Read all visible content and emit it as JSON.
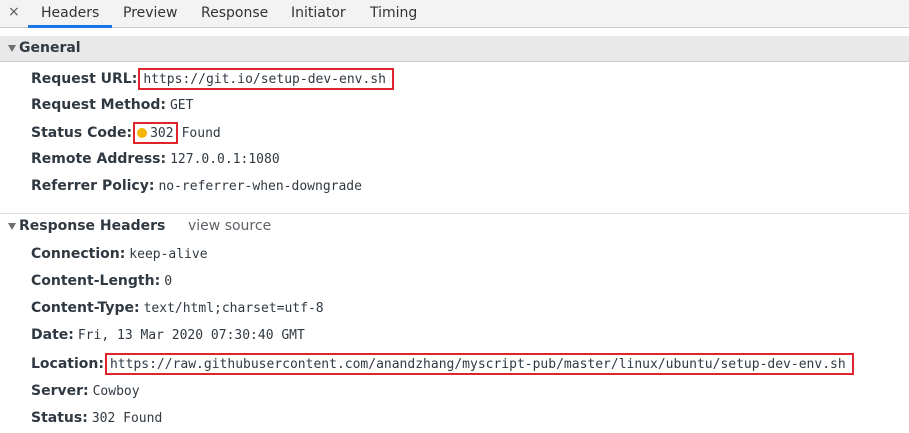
{
  "tabs": {
    "close_glyph": "×",
    "items": [
      "Headers",
      "Preview",
      "Response",
      "Initiator",
      "Timing"
    ],
    "active": "Headers",
    "accent": "#1a73e8"
  },
  "general": {
    "title": "General",
    "rows": [
      {
        "key": "Request URL:",
        "value": "https://git.io/setup-dev-env.sh"
      },
      {
        "key": "Request Method:",
        "value": "GET"
      },
      {
        "key": "Status Code:",
        "value": "302",
        "value_suffix": "Found",
        "status_color": "#f4b400"
      },
      {
        "key": "Remote Address:",
        "value": "127.0.0.1:1080"
      },
      {
        "key": "Referrer Policy:",
        "value": "no-referrer-when-downgrade"
      }
    ]
  },
  "response_headers": {
    "title": "Response Headers",
    "view_source": "view source",
    "rows": [
      {
        "key": "Connection:",
        "value": "keep-alive"
      },
      {
        "key": "Content-Length:",
        "value": "0"
      },
      {
        "key": "Content-Type:",
        "value": "text/html;charset=utf-8"
      },
      {
        "key": "Date:",
        "value": "Fri, 13 Mar 2020 07:30:40 GMT"
      },
      {
        "key": "Location:",
        "value": "https://raw.githubusercontent.com/anandzhang/myscript-pub/master/linux/ubuntu/setup-dev-env.sh"
      },
      {
        "key": "Server:",
        "value": "Cowboy"
      },
      {
        "key": "Status:",
        "value": "302 Found"
      }
    ]
  },
  "highlight_color": "#e0242b"
}
